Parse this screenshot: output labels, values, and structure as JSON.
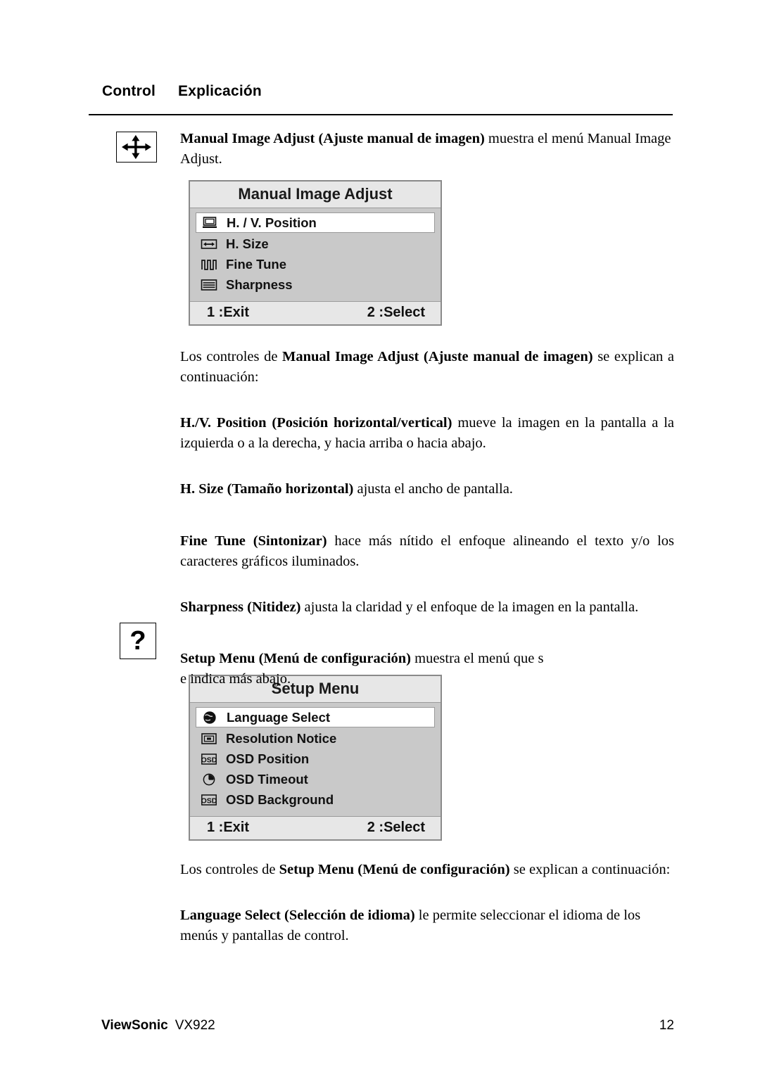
{
  "header": {
    "col1": "Control",
    "col2": "Explicación"
  },
  "controls": [
    {
      "icon": "four-way-arrows-icon",
      "intro_bold": "Manual Image Adjust (Ajuste manual de imagen)",
      "intro_rest": " muestra el menú Manual Image Adjust."
    },
    {
      "icon": "question-mark-icon",
      "icon_glyph": "?",
      "intro_bold": "Setup Menu (Menú de configuración)",
      "intro_rest": " muestra el menú que s e indica más abajo."
    }
  ],
  "osd_manual": {
    "title": "Manual Image Adjust",
    "items": [
      {
        "label": "H. / V. Position",
        "icon": "position-frame-icon",
        "selected": true
      },
      {
        "label": "H. Size",
        "icon": "horizontal-size-icon",
        "selected": false
      },
      {
        "label": "Fine Tune",
        "icon": "fine-tune-waveform-icon",
        "selected": false
      },
      {
        "label": "Sharpness",
        "icon": "sharpness-lines-icon",
        "selected": false
      }
    ],
    "footer_left": "1 :Exit",
    "footer_right": "2 :Select"
  },
  "osd_setup": {
    "title": "Setup Menu",
    "items": [
      {
        "label": "Language Select",
        "icon": "globe-icon",
        "selected": true
      },
      {
        "label": "Resolution Notice",
        "icon": "resolution-frame-icon",
        "selected": false
      },
      {
        "label": "OSD Position",
        "icon": "osd-text-icon",
        "selected": false
      },
      {
        "label": "OSD Timeout",
        "icon": "clock-icon",
        "selected": false
      },
      {
        "label": "OSD Background",
        "icon": "osd-text-icon",
        "selected": false
      }
    ],
    "footer_left": "1 :Exit",
    "footer_right": "2 :Select"
  },
  "paragraphs": {
    "p_manual_intro_bold": "Manual Image Adjust (Ajuste manual de imagen)",
    "p_manual_intro_rest": " muestra el menú Manual Image Adjust.",
    "p_controls_manual_pre": "Los controles de ",
    "p_controls_manual_bold": "Manual Image Adjust (Ajuste manual de imagen)",
    "p_controls_manual_post": " se explican a continuación:",
    "p_hv_bold": "H./V. Position (Posición horizontal/vertical)",
    "p_hv_rest": " mueve la imagen en la pantalla a la izquierda o a la derecha, y hacia arriba o hacia abajo.",
    "p_hsize_bold": "H. Size (Tamaño horizontal)",
    "p_hsize_rest": " ajusta el ancho de pantalla.",
    "p_finetune_bold": "Fine Tune (Sintonizar)",
    "p_finetune_rest": " hace más nítido el enfoque alineando el texto y/o los caracteres gráficos iluminados.",
    "p_sharpness_bold": "Sharpness (Nitidez)",
    "p_sharpness_rest": " ajusta la claridad y el enfoque de la imagen en la pantalla.",
    "p_setup_intro_bold": "Setup Menu (Menú de configuración)",
    "p_setup_intro_rest": " muestra el menú que s",
    "p_setup_intro_line2": "e indica más abajo.",
    "p_controls_setup_pre": "Los controles de ",
    "p_controls_setup_bold": "Setup Menu (Menú de configuración)",
    "p_controls_setup_post": " se explican a continuación:",
    "p_language_bold": "Language Select (Selección de idioma)",
    "p_language_rest": " le permite seleccionar el idioma de los menús y pantallas de control."
  },
  "footer": {
    "brand": "ViewSonic",
    "model": "VX922",
    "page_number": "12"
  },
  "colors": {
    "osd_body": "#c9c9c9",
    "osd_title_bar": "#e7e7e7",
    "osd_border": "#8a8a8a",
    "selected_row": "#ffffff",
    "text": "#000000"
  }
}
